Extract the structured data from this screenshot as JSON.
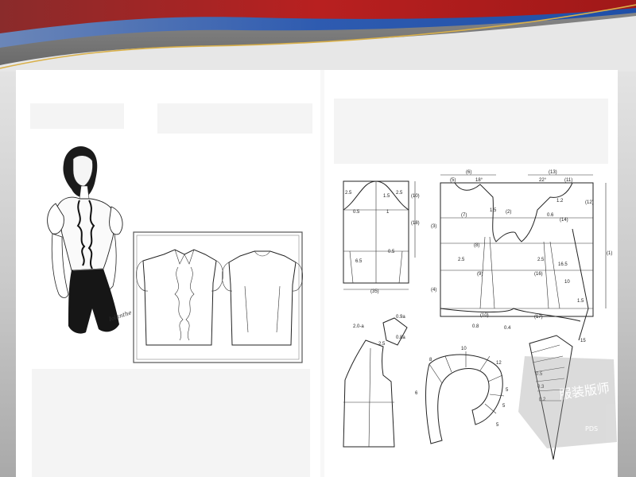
{
  "slide": {
    "banner_colors": {
      "red": "#b01e1e",
      "blue": "#1f4fa8",
      "gold": "#d9b04a",
      "gray": "#7a7a7a"
    }
  },
  "sketch": {
    "signature": "Iolanthe"
  },
  "sleeve_draft": {
    "labels": {
      "top_left": "2.5",
      "top_right": "2.5",
      "mark_a": "1.5",
      "mark_b": "0.5",
      "mark_c": "1",
      "height": "(18)",
      "side": "(3)",
      "low_left": "6.5",
      "low_right": "0.5",
      "width": "(35)",
      "extra": "(10)"
    }
  },
  "bodice_draft": {
    "labels": {
      "back_width": "(6)",
      "neck_w": "(5)",
      "angle_back": "18°",
      "front_width": "(13)",
      "angle_front": "22°",
      "front_extra": "(11)",
      "shoulder": "1.5",
      "cb_length": "(2)",
      "back_depth": "(7)",
      "front_depth": "(14)",
      "armhole": "(8)",
      "dart_a": "2.5",
      "dart_b": "2.5",
      "dart_c": "16.5",
      "waist_b": "(9)",
      "waist_f": "(16)",
      "height_r": "(12)",
      "length": "(1)",
      "length_l": "(3)",
      "length_l2": "(4)",
      "hem_b": "(10)",
      "hem_f": "(17)",
      "hem_dim_a": "0.8",
      "hem_dim_b": "0.4",
      "side_c": "1.5",
      "neck_f": "1.2",
      "neck_dot": "0.6",
      "bust": "10"
    }
  },
  "front_piece": {
    "labels": {
      "collar": "2.0-a",
      "c1": "0.9a",
      "c2": "0.8a",
      "c3": "2.5"
    }
  },
  "ruffle": {
    "labels": {
      "n8": "8",
      "n10": "10",
      "n12": "12",
      "n6": "6",
      "n5a": "5",
      "n5b": "5",
      "n5c": "5"
    }
  },
  "frill_piece": {
    "labels": {
      "a": "0.5",
      "b": "0.3",
      "c": "0.2",
      "d": "15"
    }
  },
  "watermark": {
    "text": "服装版师",
    "sub": "PDS"
  }
}
